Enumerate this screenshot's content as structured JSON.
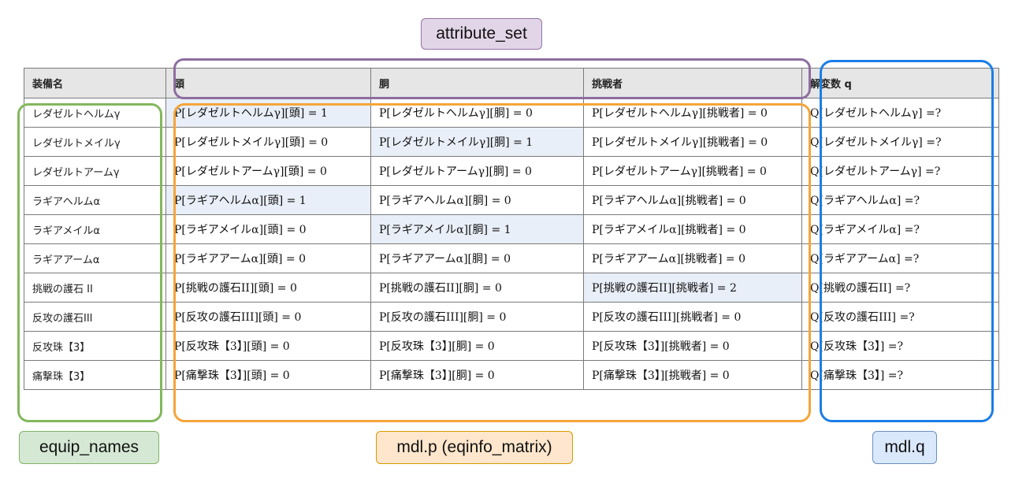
{
  "labels": {
    "attribute_set": "attribute_set",
    "equip_names": "equip_names",
    "mdl_p": "mdl.p (eqinfo_matrix)",
    "mdl_q": "mdl.q"
  },
  "colors": {
    "attribute_set": "#8d6e9f",
    "equip_names": "#83b75c",
    "mdl_p": "#f5a53a",
    "mdl_q": "#1b7ee7",
    "highlight": "#e9eff8",
    "header_bg": "#e6e6e6"
  },
  "table": {
    "headers": [
      "装備名",
      "頭",
      "胴",
      "挑戦者",
      "解変数 q"
    ],
    "rows": [
      {
        "name": "レダゼルトヘルムγ",
        "head": "P[レダゼルトヘルムγ][頭] = 1",
        "body": "P[レダゼルトヘルムγ][胴] = 0",
        "challenger": "P[レダゼルトヘルムγ][挑戦者] = 0",
        "q": "Q[レダゼルトヘルムγ] =?",
        "highlight": "head"
      },
      {
        "name": "レダゼルトメイルγ",
        "head": "P[レダゼルトメイルγ][頭] = 0",
        "body": "P[レダゼルトメイルγ][胴] = 1",
        "challenger": "P[レダゼルトメイルγ][挑戦者] = 0",
        "q": "Q[レダゼルトメイルγ] =?",
        "highlight": "body"
      },
      {
        "name": "レダゼルトアームγ",
        "head": "P[レダゼルトアームγ][頭] = 0",
        "body": "P[レダゼルトアームγ][胴] = 0",
        "challenger": "P[レダゼルトアームγ][挑戦者] = 0",
        "q": "Q[レダゼルトアームγ] =?",
        "highlight": ""
      },
      {
        "name": "ラギアヘルムα",
        "head": "P[ラギアヘルムα][頭] = 1",
        "body": "P[ラギアヘルムα][胴] = 0",
        "challenger": "P[ラギアヘルムα][挑戦者] = 0",
        "q": "Q[ラギアヘルムα] =?",
        "highlight": "head"
      },
      {
        "name": "ラギアメイルα",
        "head": "P[ラギアメイルα][頭] = 0",
        "body": "P[ラギアメイルα][胴] = 1",
        "challenger": "P[ラギアメイルα][挑戦者] = 0",
        "q": "Q[ラギアメイルα] =?",
        "highlight": "body"
      },
      {
        "name": "ラギアアームα",
        "head": "P[ラギアアームα][頭] = 0",
        "body": "P[ラギアアームα][胴] = 0",
        "challenger": "P[ラギアアームα][挑戦者] = 0",
        "q": "Q[ラギアアームα] =?",
        "highlight": ""
      },
      {
        "name": "挑戦の護石 II",
        "head": "P[挑戦の護石II][頭] = 0",
        "body": "P[挑戦の護石II][胴] = 0",
        "challenger": "P[挑戦の護石II][挑戦者] = 2",
        "q": "Q[挑戦の護石II] =?",
        "highlight": "challenger"
      },
      {
        "name": "反攻の護石III",
        "head": "P[反攻の護石III][頭] = 0",
        "body": "P[反攻の護石III][胴] = 0",
        "challenger": "P[反攻の護石III][挑戦者] = 0",
        "q": "Q[反攻の護石III] =?",
        "highlight": ""
      },
      {
        "name": "反攻珠【3】",
        "head": "P[反攻珠【3】][頭] = 0",
        "body": "P[反攻珠【3】][胴] = 0",
        "challenger": "P[反攻珠【3】][挑戦者] = 0",
        "q": "Q[反攻珠【3】] =?",
        "highlight": ""
      },
      {
        "name": "痛撃珠【3】",
        "head": "P[痛撃珠【3】][頭] = 0",
        "body": "P[痛撃珠【3】][胴] = 0",
        "challenger": "P[痛撃珠【3】][挑戦者] = 0",
        "q": "Q[痛撃珠【3】] =?",
        "highlight": ""
      }
    ]
  }
}
